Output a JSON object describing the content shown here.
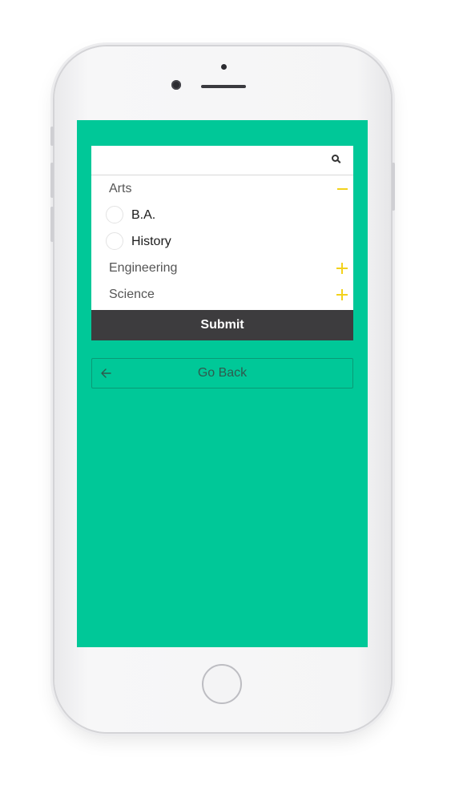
{
  "search": {
    "value": "",
    "placeholder": ""
  },
  "tree": {
    "categories": [
      {
        "label": "Arts",
        "state": "expanded",
        "options": [
          {
            "label": "B.A."
          },
          {
            "label": "History"
          }
        ]
      },
      {
        "label": "Engineering",
        "state": "collapsed"
      },
      {
        "label": "Science",
        "state": "collapsed"
      }
    ]
  },
  "actions": {
    "submit_label": "Submit",
    "go_back_label": "Go Back"
  },
  "icons": {
    "search": "search-icon",
    "collapse": "minus-icon",
    "expand": "plus-icon",
    "back": "arrow-left-icon"
  },
  "colors": {
    "screen_background": "#00c898",
    "accent_toggle": "#f3d21b",
    "submit_background": "#3d3c3e",
    "go_back_border": "#0a9a76"
  }
}
